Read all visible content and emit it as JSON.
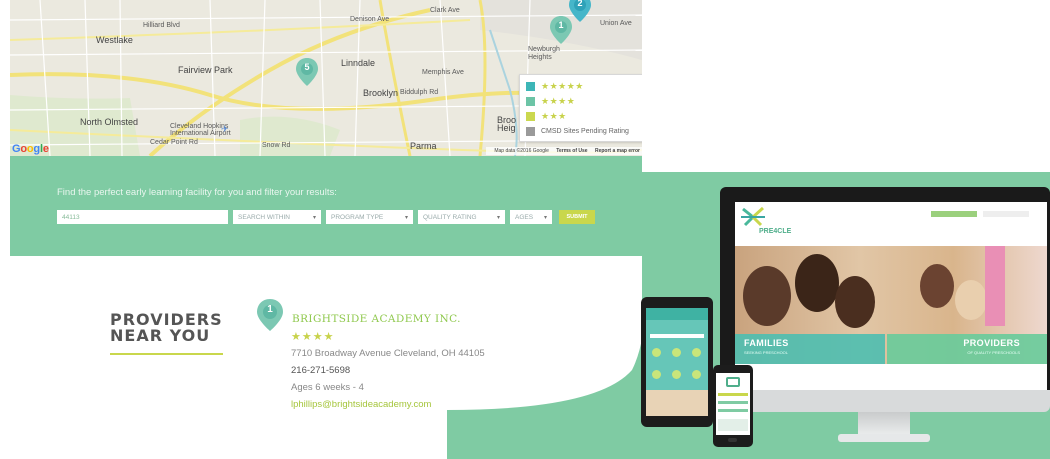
{
  "map": {
    "labels": {
      "westlake": "Westlake",
      "fairview_park": "Fairview Park",
      "linndale": "Linndale",
      "brooklyn": "Brooklyn",
      "newburgh_heights": "Newburgh Heights",
      "north_olmsted": "North Olmsted",
      "cleveland_hopkins": "Cleveland Hopkins International Airport",
      "parma": "Parma",
      "memphis_ave": "Memphis Ave",
      "biddulph_rd": "Biddulph Rd",
      "hilliard_blvd": "Hilliard Blvd",
      "clark_ave": "Clark Ave",
      "union_ave": "Union Ave",
      "denison_ave": "Denison Ave",
      "cedar_point_rd": "Cedar Point Rd",
      "snow_rd": "Snow Rd",
      "broo": "Broo",
      "heig": "Heig"
    },
    "pins": {
      "pin_one": "1",
      "pin_two": "2",
      "pin_five": "5"
    },
    "google_logo": "Google",
    "footer": {
      "map_data": "Map data ©2016 Google",
      "terms": "Terms of Use",
      "report": "Report a map error"
    },
    "legend": {
      "five_stars": "★★★★★",
      "four_stars": "★★★★",
      "three_stars": "★★★",
      "pending": "CMSD Sites Pending Rating"
    }
  },
  "search": {
    "title": "Find the perfect early learning facility for you and filter your results:",
    "zip_value": "44113",
    "search_within": "SEARCH WITHIN",
    "program_type": "PROGRAM TYPE",
    "quality_rating": "QUALITY RATING",
    "ages": "AGES",
    "submit": "SUBMIT",
    "caret": "▾"
  },
  "providers": {
    "heading_line1": "PROVIDERS",
    "heading_line2": "NEAR YOU",
    "pin_number": "1",
    "name": "BRIGHTSIDE ACADEMY INC.",
    "stars": "★★★★",
    "address": "7710 Broadway Avenue Cleveland, OH 44105",
    "phone": "216-271-5698",
    "ages": "Ages 6 weeks - 4",
    "email": "lphillips@brightsideacademy.com"
  },
  "devices": {
    "logo": "PRE4CLE",
    "families": "FAMILIES",
    "families_sub": "SEEKING PRESCHOOL",
    "providers": "PROVIDERS",
    "providers_sub": "OF QUALITY PRESCHOOLS"
  },
  "colors": {
    "band_green": "#7fcba3",
    "accent_lime": "#c9d74c",
    "pin_teal": "#5fb8a4",
    "legend_teal_1": "#3db6b7",
    "legend_teal_2": "#6cc4a6",
    "legend_lime": "#cbd84f",
    "legend_gray": "#9a9a9a"
  }
}
